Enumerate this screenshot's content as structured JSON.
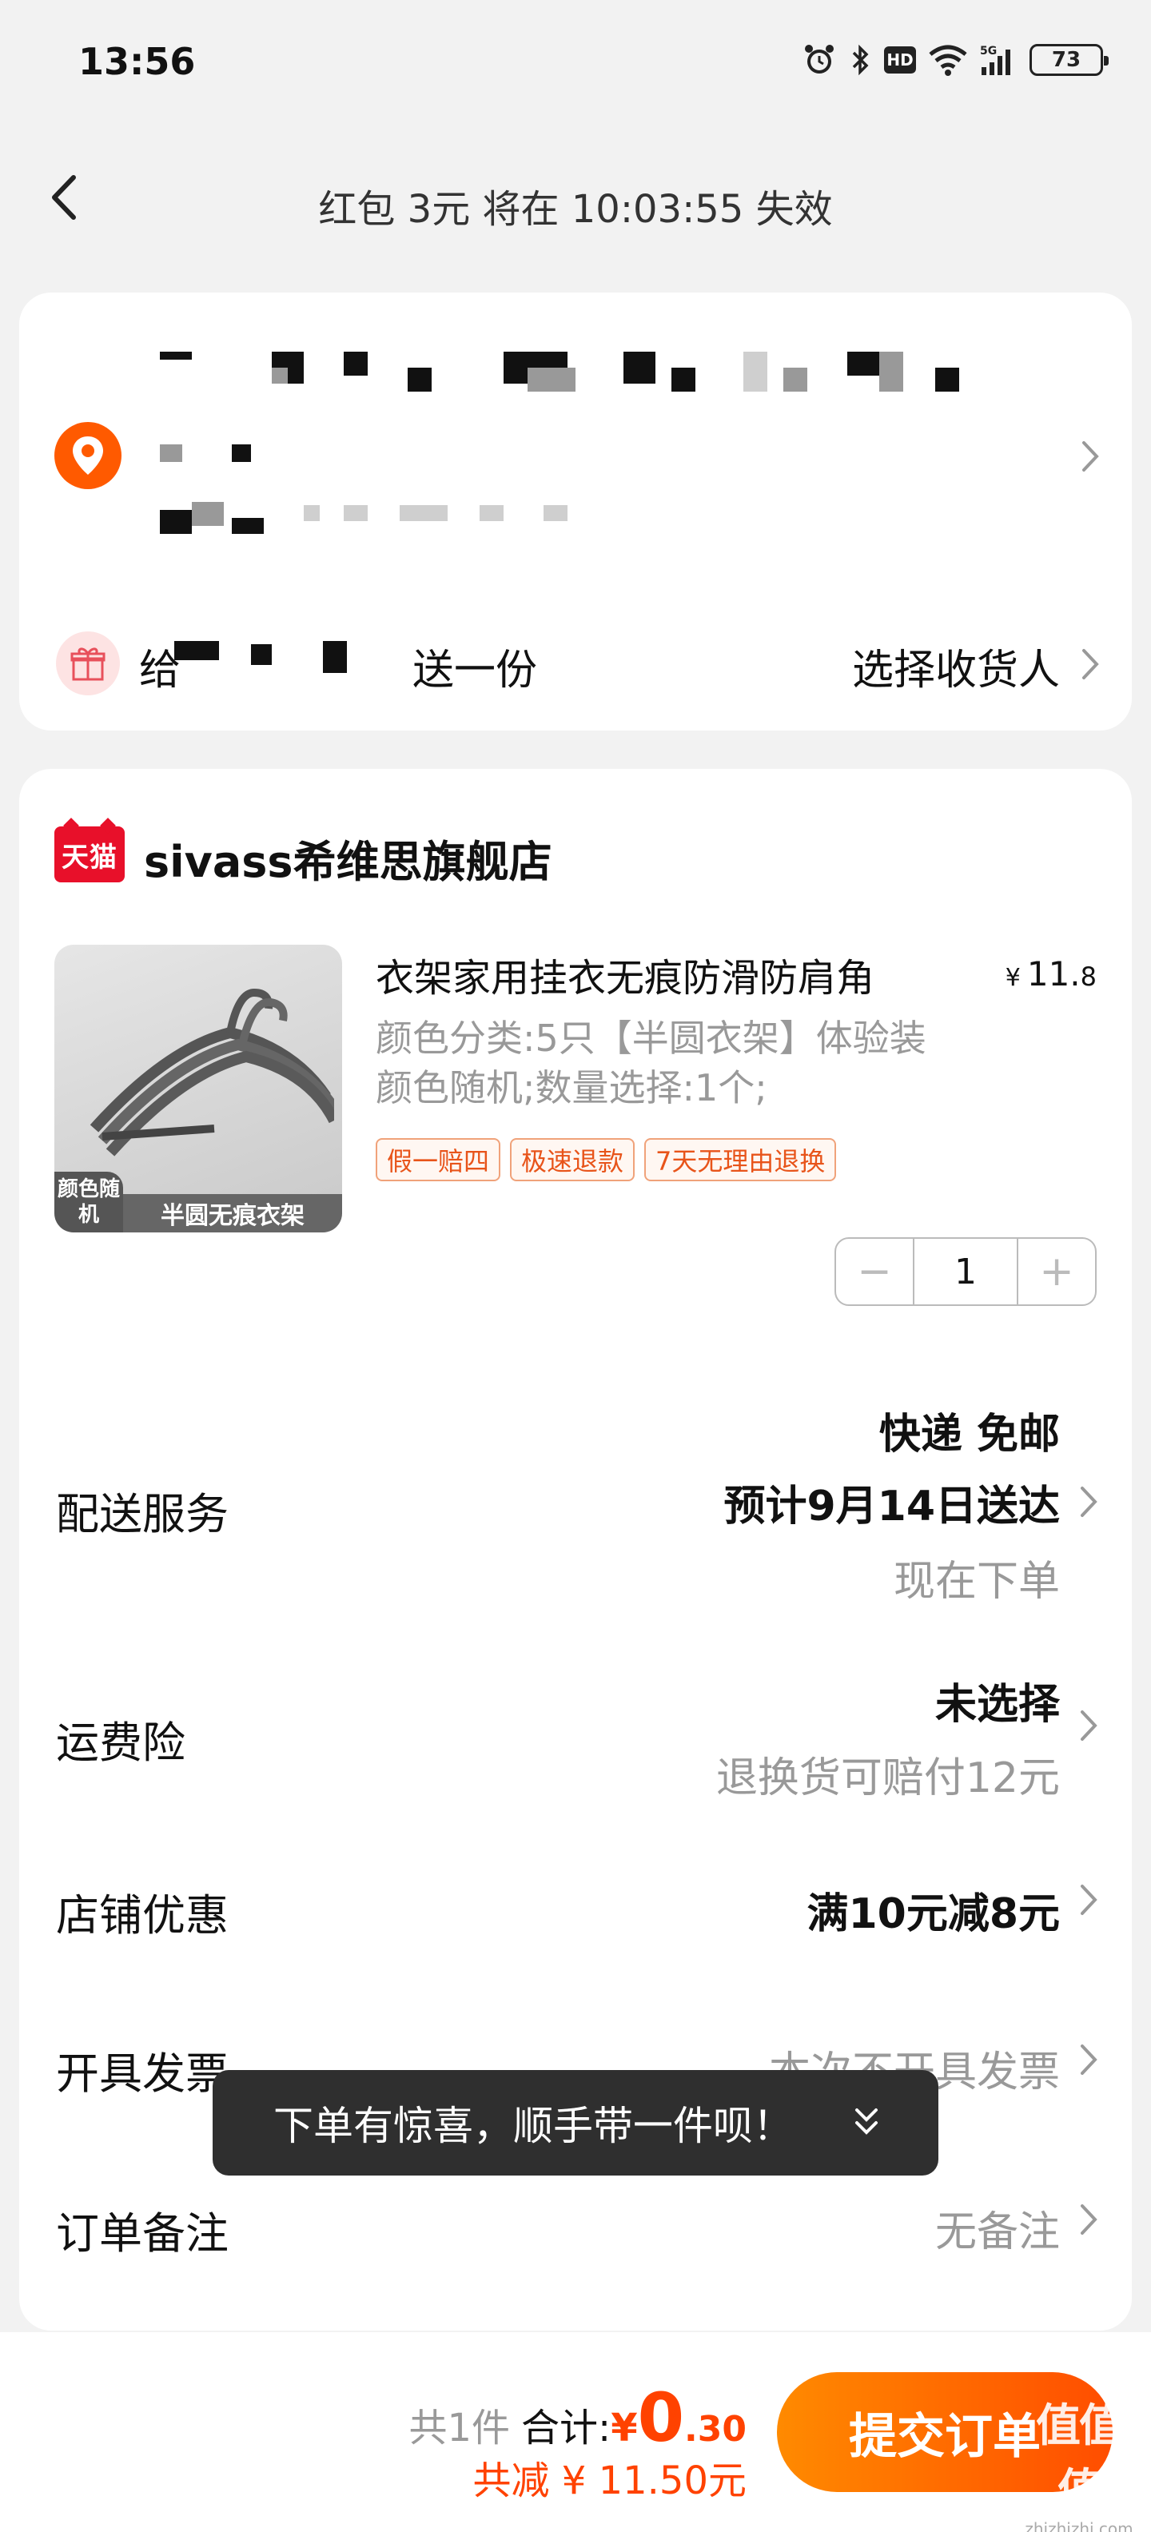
{
  "status_bar": {
    "time": "13:56",
    "battery": "73",
    "network": "5G",
    "hd_badge": "HD"
  },
  "header": {
    "countdown_text": "红包 3元 将在 10:03:55 失效"
  },
  "address": {
    "gift_prefix": "给",
    "gift_suffix": "送一份",
    "choose_recipient": "选择收货人"
  },
  "store": {
    "logo_text": "天猫",
    "name": "sivass希维思旗舰店"
  },
  "product": {
    "title": "衣架家用挂衣无痕防滑防肩角",
    "price_currency": "¥",
    "price_int": "11.",
    "price_dec": "8",
    "spec": "颜色分类:5只【半圆衣架】体验装 颜色随机;数量选择:1个;",
    "image_tag_left": "颜色随机",
    "image_tag_right": "半圆无痕衣架",
    "tags": [
      "假一赔四",
      "极速退款",
      "7天无理由退换"
    ],
    "quantity": "1"
  },
  "rows": {
    "delivery_label": "配送服务",
    "delivery_line1": "快递 免邮",
    "delivery_line2": "预计9月14日送达",
    "delivery_line3": "现在下单",
    "insurance_label": "运费险",
    "insurance_line1": "未选择",
    "insurance_line2": "退换货可赔付12元",
    "discount_label": "店铺优惠",
    "discount_value": "满10元减8元",
    "invoice_label": "开具发票",
    "invoice_value": "本次不开具发票",
    "note_label": "订单备注",
    "note_value": "无备注"
  },
  "toast": {
    "text": "下单有惊喜，顺手带一件呗！"
  },
  "bottom": {
    "count": "共1件",
    "total_label": "合计:",
    "total_currency": "¥",
    "total_int": "0",
    "total_dec": ".30",
    "saved": "共减 ¥ 11.50元",
    "submit_label": "提交订单"
  },
  "watermark": {
    "big": "值值值",
    "small": "zhizhizhi.com"
  },
  "colors": {
    "accent": "#ff4d00",
    "tmall_red": "#e8102a",
    "pin_orange": "#ff5a00"
  }
}
